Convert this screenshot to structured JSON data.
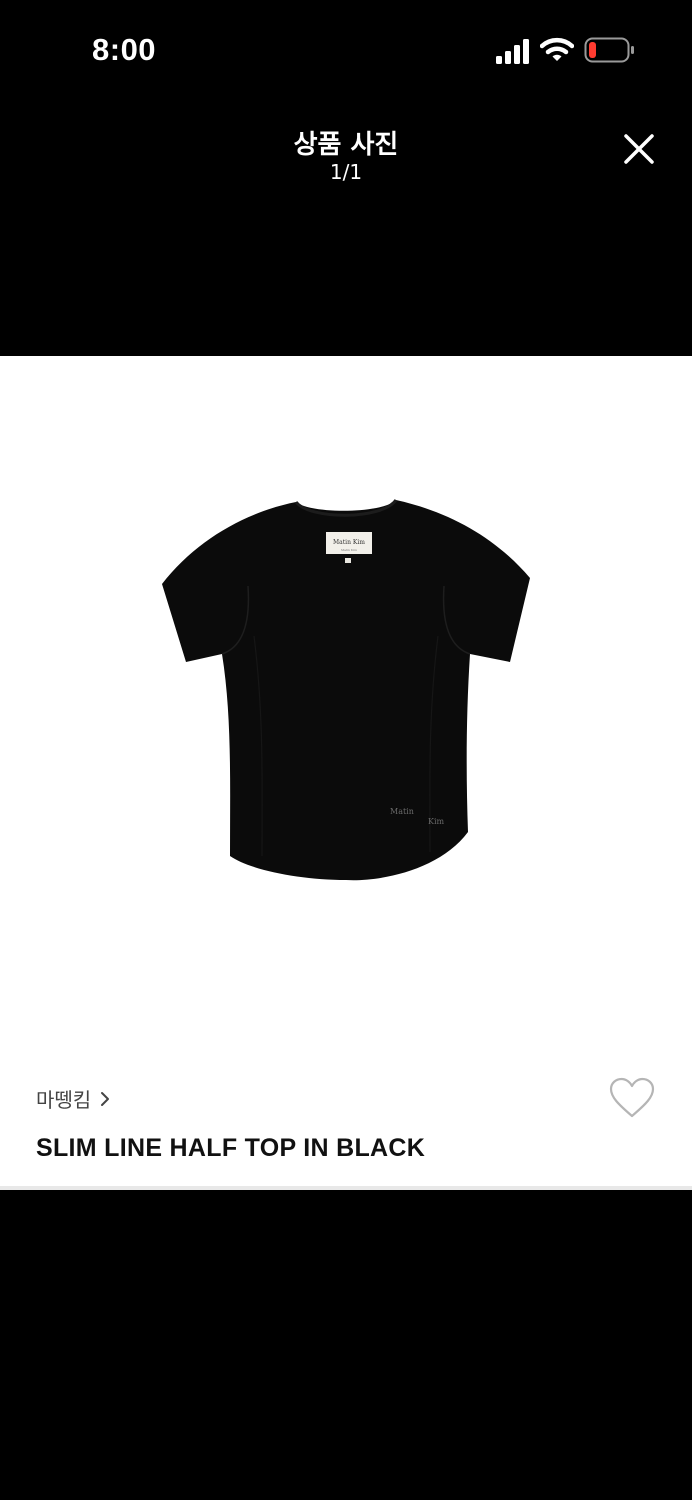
{
  "status_bar": {
    "time": "8:00",
    "icons": [
      "cellular-signal-icon",
      "wifi-icon",
      "battery-low-icon"
    ],
    "battery_color": "#ff3b30"
  },
  "header": {
    "title": "상품 사진",
    "counter": "1/1",
    "close_icon": "close-icon"
  },
  "photo": {
    "label_text": "Matin Kim",
    "label_subtext": "Matin Kim",
    "print_text_1": "Matin",
    "print_text_2": "Kim"
  },
  "product": {
    "brand": "마뗑킴",
    "name": "SLIM LINE HALF TOP IN BLACK",
    "wishlist_icon": "heart-outline-icon"
  },
  "colors": {
    "background": "#000000",
    "surface": "#ffffff",
    "text_primary": "#111111",
    "text_secondary": "#444444"
  }
}
